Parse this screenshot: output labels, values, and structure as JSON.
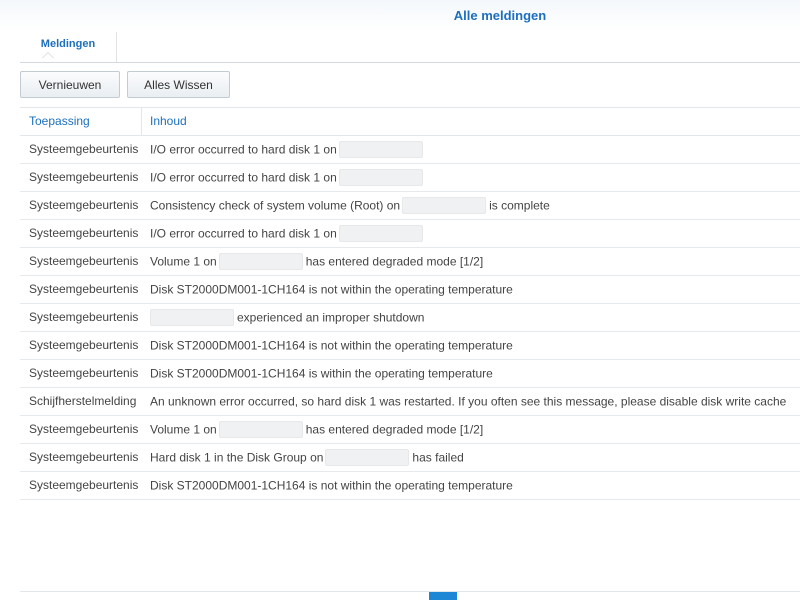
{
  "window": {
    "title": "Alle meldingen"
  },
  "tabs": [
    {
      "label": "Meldingen",
      "active": true
    }
  ],
  "toolbar": {
    "refresh_label": "Vernieuwen",
    "clear_label": "Alles Wissen"
  },
  "columns": {
    "app": "Toepassing",
    "content": "Inhoud"
  },
  "rows": [
    {
      "app": "Systeemgebeurtenis",
      "pre": "I/O error occurred to hard disk 1 on",
      "redacted": true,
      "post": ""
    },
    {
      "app": "Systeemgebeurtenis",
      "pre": "I/O error occurred to hard disk 1 on",
      "redacted": true,
      "post": ""
    },
    {
      "app": "Systeemgebeurtenis",
      "pre": "Consistency check of system volume (Root) on",
      "redacted": true,
      "post": "is complete"
    },
    {
      "app": "Systeemgebeurtenis",
      "pre": "I/O error occurred to hard disk 1 on",
      "redacted": true,
      "post": ""
    },
    {
      "app": "Systeemgebeurtenis",
      "pre": "Volume 1 on",
      "redacted": true,
      "post": "has entered degraded mode [1/2]"
    },
    {
      "app": "Systeemgebeurtenis",
      "pre": "Disk ST2000DM001-1CH164 is not within the operating temperature",
      "redacted": false,
      "post": ""
    },
    {
      "app": "Systeemgebeurtenis",
      "pre": "",
      "redacted": true,
      "post": "experienced an improper shutdown"
    },
    {
      "app": "Systeemgebeurtenis",
      "pre": "Disk ST2000DM001-1CH164 is not within the operating temperature",
      "redacted": false,
      "post": ""
    },
    {
      "app": "Systeemgebeurtenis",
      "pre": "Disk ST2000DM001-1CH164 is within the operating temperature",
      "redacted": false,
      "post": ""
    },
    {
      "app": "Schijfherstelmelding",
      "pre": "An unknown error occurred, so hard disk 1 was restarted. If you often see this message, please disable disk write cache",
      "redacted": false,
      "post": ""
    },
    {
      "app": "Systeemgebeurtenis",
      "pre": "Volume 1 on",
      "redacted": true,
      "post": "has entered degraded mode [1/2]"
    },
    {
      "app": "Systeemgebeurtenis",
      "pre": "Hard disk 1 in the Disk Group on",
      "redacted": true,
      "post": "has failed"
    },
    {
      "app": "Systeemgebeurtenis",
      "pre": "Disk ST2000DM001-1CH164 is not within the operating temperature",
      "redacted": false,
      "post": ""
    }
  ],
  "colors": {
    "accent": "#1d6fbe",
    "scroll_indicator": "#1d87d6"
  }
}
